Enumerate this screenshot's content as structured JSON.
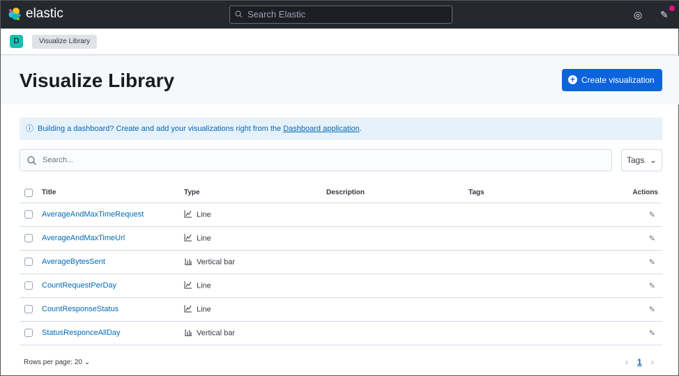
{
  "topbar": {
    "brand": "elastic",
    "search_placeholder": "Search Elastic"
  },
  "breadcrumb": {
    "space_initial": "D",
    "current": "Visualize Library"
  },
  "page": {
    "title": "Visualize Library",
    "create_label": "Create visualization"
  },
  "callout": {
    "text": "Building a dashboard? Create and add your visualizations right from the ",
    "link": "Dashboard application",
    "end": "."
  },
  "search": {
    "placeholder": "Search..."
  },
  "tags_filter": "Tags",
  "table": {
    "headers": {
      "title": "Title",
      "type": "Type",
      "description": "Description",
      "tags": "Tags",
      "actions": "Actions"
    },
    "rows": [
      {
        "title": "AverageAndMaxTimeRequest",
        "type": "Line",
        "icon": "line"
      },
      {
        "title": "AverageAndMaxTimeUrl",
        "type": "Line",
        "icon": "line"
      },
      {
        "title": "AverageBytesSent",
        "type": "Vertical bar",
        "icon": "bar"
      },
      {
        "title": "CountRequestPerDay",
        "type": "Line",
        "icon": "line"
      },
      {
        "title": "CountResponseStatus",
        "type": "Line",
        "icon": "line"
      },
      {
        "title": "StatusResponceAllDay",
        "type": "Vertical bar",
        "icon": "bar"
      }
    ]
  },
  "footer": {
    "rows_per_page": "Rows per page: 20",
    "page": "1"
  }
}
